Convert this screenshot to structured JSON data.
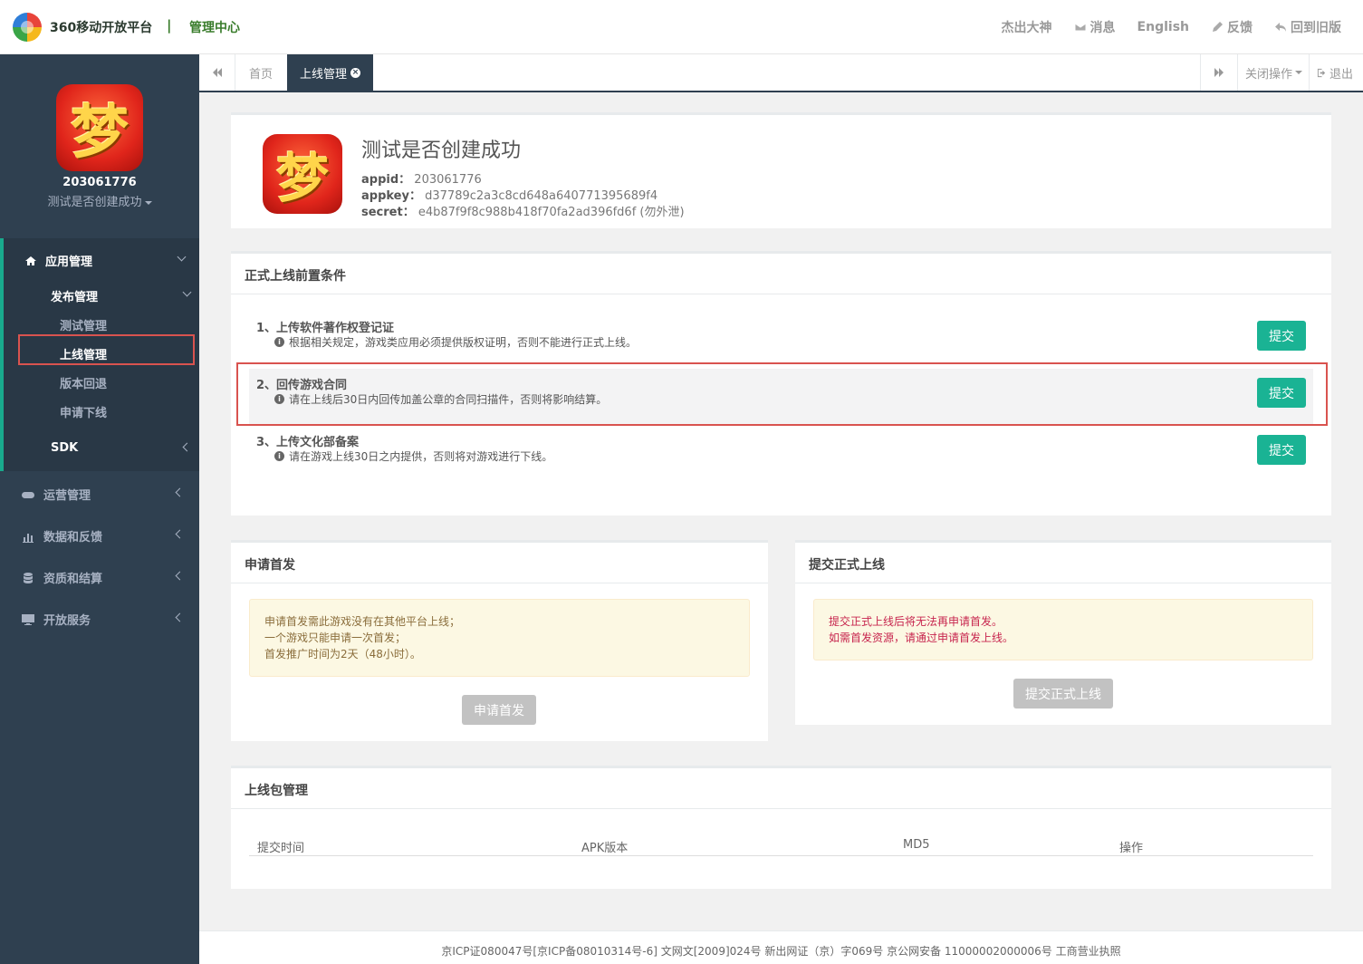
{
  "header": {
    "brand": "360移动开放平台",
    "separator": "|",
    "subtitle": "管理中心",
    "links": {
      "masters": "杰出大神",
      "messages": "消息",
      "english": "English",
      "feedback": "反馈",
      "old_version": "回到旧版"
    }
  },
  "sidebar": {
    "app_id": "203061776",
    "app_name": "测试是否创建成功",
    "app_icon_glyph": "梦",
    "menu": {
      "app_manage": "应用管理",
      "publish_manage": "发布管理",
      "test_manage": "测试管理",
      "online_manage": "上线管理",
      "version_rollback": "版本回退",
      "apply_offline": "申请下线",
      "sdk": "SDK",
      "operations": "运营管理",
      "data_feedback": "数据和反馈",
      "qualification": "资质和结算",
      "open_service": "开放服务"
    }
  },
  "tabs": {
    "home": "首页",
    "current": "上线管理",
    "close_ops": "关闭操作",
    "logout": "退出"
  },
  "app_info": {
    "title": "测试是否创建成功",
    "appid_label": "appid：",
    "appid": "203061776",
    "appkey_label": "appkey：",
    "appkey": "d37789c2a3c8cd648a640771395689f4",
    "secret_label": "secret：",
    "secret": "e4b87f9f8c988b418f70fa2ad396fd6f (勿外泄)"
  },
  "prereq": {
    "title": "正式上线前置条件",
    "items": [
      {
        "title": "1、上传软件著作权登记证",
        "desc": "根据相关规定，游戏类应用必须提供版权证明，否则不能进行正式上线。",
        "button": "提交"
      },
      {
        "title": "2、回传游戏合同",
        "desc": "请在上线后30日内回传加盖公章的合同扫描件，否则将影响结算。",
        "button": "提交"
      },
      {
        "title": "3、上传文化部备案",
        "desc": "请在游戏上线30日之内提供，否则将对游戏进行下线。",
        "button": "提交"
      }
    ]
  },
  "first_launch": {
    "title": "申请首发",
    "notes": [
      "申请首发需此游戏没有在其他平台上线；",
      "一个游戏只能申请一次首发；",
      "首发推广时间为2天（48小时）。"
    ],
    "button": "申请首发"
  },
  "submit_online": {
    "title": "提交正式上线",
    "notes": [
      "提交正式上线后将无法再申请首发。",
      "如需首发资源，请通过申请首发上线。"
    ],
    "button": "提交正式上线"
  },
  "packages": {
    "title": "上线包管理",
    "columns": [
      "提交时间",
      "APK版本",
      "MD5",
      "操作"
    ]
  },
  "footer": {
    "text": "京ICP证080047号[京ICP备08010314号-6] 文网文[2009]024号 新出网证（京）字069号 京公网安备 11000002000006号 工商营业执照"
  },
  "colors": {
    "sidebar_bg": "#2f4050",
    "accent_green": "#1ab394",
    "highlight_red": "#d9534f",
    "alert_red_text": "#c7254e"
  }
}
